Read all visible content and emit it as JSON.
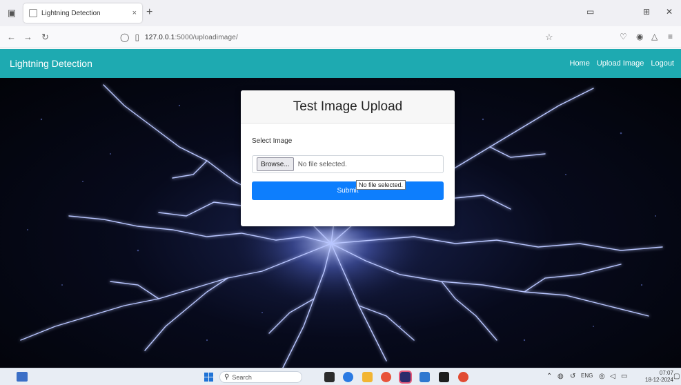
{
  "browser": {
    "tab_title": "Lightning Detection",
    "tab_close": "×",
    "new_tab": "+",
    "url_host": "127.0.0.1",
    "url_path": ":5000/uploadimage/"
  },
  "app": {
    "brand": "Lightning Detection",
    "nav_links": [
      "Home",
      "Upload Image",
      "Logout"
    ]
  },
  "upload": {
    "title": "Test Image Upload",
    "field_label": "Select Image",
    "browse_label": "Browse...",
    "file_status": "No file selected.",
    "submit_label": "Submit",
    "tooltip": "No file selected."
  },
  "taskbar": {
    "search_placeholder": "Search",
    "weather": "ENG",
    "time": "07:07",
    "date": "18-12-2024"
  },
  "colors": {
    "accent": "#1eaab1",
    "primary_button": "#0d7efd"
  }
}
